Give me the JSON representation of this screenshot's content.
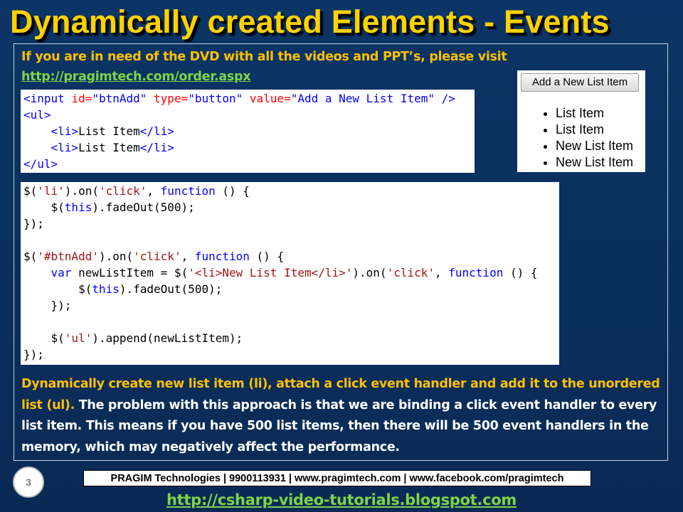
{
  "slide": {
    "title": "Dynamically created Elements - Events",
    "number": "3"
  },
  "intro": {
    "text": "If you are in need of the DVD with all the videos and PPT’s, please visit",
    "link": "http://pragimtech.com/order.aspx"
  },
  "html_code": {
    "line1": {
      "open": "<input ",
      "attr1": "id=",
      "val1": "\"btnAdd\"",
      "attr2": " type=",
      "val2": "\"button\"",
      "attr3": " value=",
      "val3": "\"Add a New List Item\"",
      "close": " />"
    },
    "line2": "<ul>",
    "line3": {
      "indent": "    ",
      "open": "<li>",
      "text": "List Item",
      "close": "</li>"
    },
    "line4": {
      "indent": "    ",
      "open": "<li>",
      "text": "List Item",
      "close": "</li>"
    },
    "line5": "</ul>"
  },
  "js_code": {
    "l1": {
      "a": "$(",
      "s1": "'li'",
      "b": ").on(",
      "s2": "'click'",
      "c": ", ",
      "kw": "function",
      "d": " () {"
    },
    "l2": {
      "a": "    $(",
      "kw": "this",
      "b": ").fadeOut(500);"
    },
    "l3": "});",
    "l4": "",
    "l5": {
      "a": "$(",
      "s1": "'#btnAdd'",
      "b": ").on(",
      "s2": "'click'",
      "c": ", ",
      "kw": "function",
      "d": " () {"
    },
    "l6": {
      "a": "    ",
      "kw1": "var",
      "b": " newListItem = $(",
      "s1": "'<li>New List Item</li>'",
      "c": ").on(",
      "s2": "'click'",
      "d": ", ",
      "kw2": "function",
      "e": " () {"
    },
    "l7": {
      "a": "        $(",
      "kw": "this",
      "b": ").fadeOut(500);"
    },
    "l8": "    });",
    "l9": "",
    "l10": {
      "a": "    $(",
      "s1": "'ul'",
      "b": ").append(newListItem);"
    },
    "l11": "});"
  },
  "preview": {
    "button_label": "Add a New List Item",
    "items": [
      "List Item",
      "List Item",
      "New List Item",
      "New List Item"
    ]
  },
  "explanation": {
    "highlight": "Dynamically create new list item (li), attach a click event handler and add it to the unordered list (ul).",
    "rest": " The problem with this approach is that we are binding a click event handler to every list item. This means if you have 500 list items, then there will be 500 event handlers in the memory, which may negatively affect the performance."
  },
  "footer": {
    "contact": "PRAGIM Technologies | 9900113931 | www.pragimtech.com | www.facebook.com/pragimtech",
    "blog_link": "http://csharp-video-tutorials.blogspot.com"
  },
  "colors": {
    "background": "#0a2f5c",
    "title": "#ffd200",
    "highlight_text": "#ffc000",
    "link": "#7ed348",
    "body_text": "#ffffff"
  }
}
